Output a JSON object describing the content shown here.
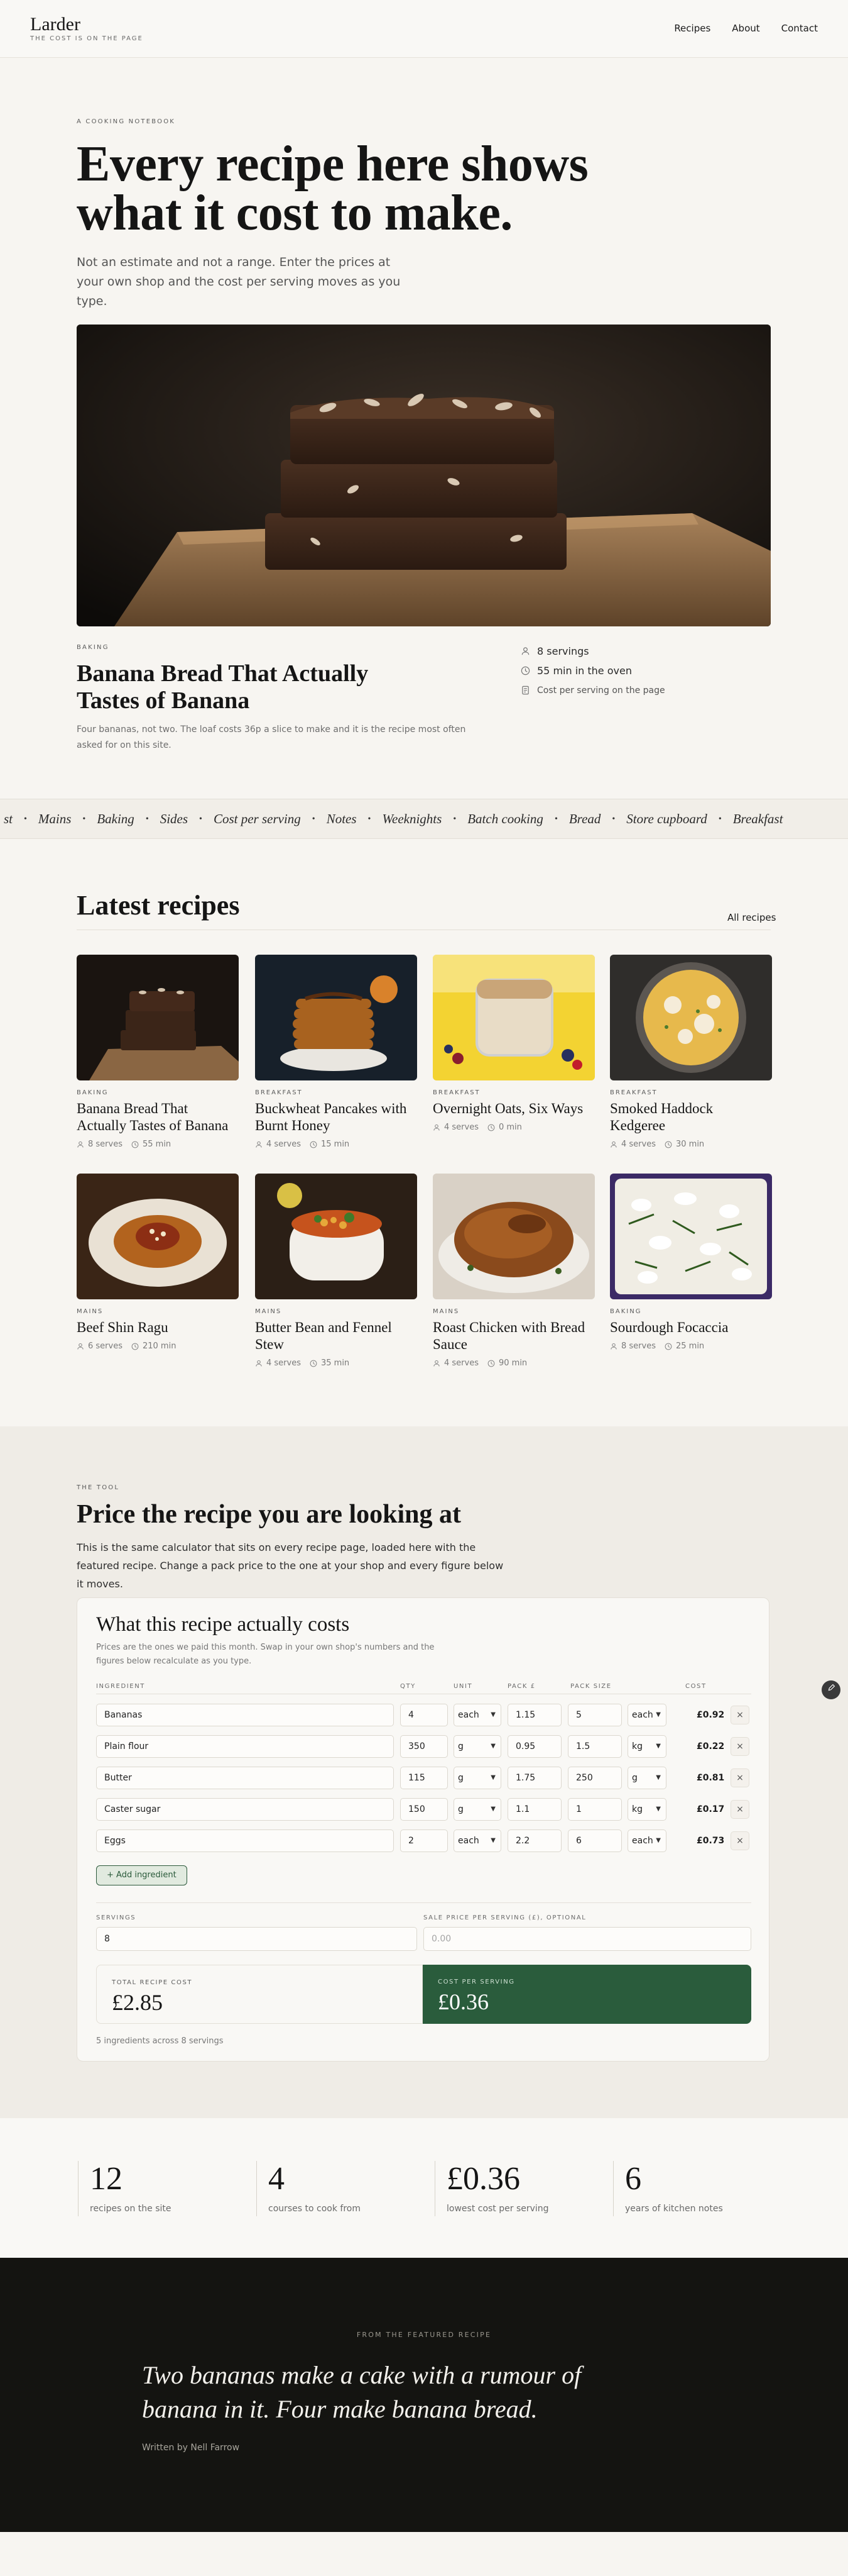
{
  "header": {
    "logo": "Larder",
    "tagline": "THE COST IS ON THE PAGE",
    "nav": [
      "Recipes",
      "About",
      "Contact"
    ]
  },
  "hero": {
    "eyebrow": "A COOKING NOTEBOOK",
    "title": "Every recipe here shows what it cost to make.",
    "lede": "Not an estimate and not a range. Enter the prices at your own shop and the cost per serving moves as you type."
  },
  "featured": {
    "category": "BAKING",
    "title": "Banana Bread That Actually Tastes of Banana",
    "blurb": "Four bananas, not two. The loaf costs 36p a slice to make and it is the recipe most often asked for on this site.",
    "servings": "8 servings",
    "time": "55 min in the oven",
    "cost_note": "Cost per serving on the page"
  },
  "ticker": [
    "st",
    "Mains",
    "Baking",
    "Sides",
    "Cost per serving",
    "Notes",
    "Weeknights",
    "Batch cooking",
    "Bread",
    "Store cupboard",
    "Breakfast"
  ],
  "latest": {
    "title": "Latest recipes",
    "all_link": "All recipes",
    "cards": [
      {
        "category": "BAKING",
        "title": "Banana Bread That Actually Tastes of Banana",
        "serves": "8 serves",
        "time": "55 min",
        "image": "banana-bread"
      },
      {
        "category": "BREAKFAST",
        "title": "Buckwheat Pancakes with Burnt Honey",
        "serves": "4 serves",
        "time": "15 min",
        "image": "pancakes"
      },
      {
        "category": "BREAKFAST",
        "title": "Overnight Oats, Six Ways",
        "serves": "4 serves",
        "time": "0 min",
        "image": "oats"
      },
      {
        "category": "BREAKFAST",
        "title": "Smoked Haddock Kedgeree",
        "serves": "4 serves",
        "time": "30 min",
        "image": "kedgeree"
      },
      {
        "category": "MAINS",
        "title": "Beef Shin Ragu",
        "serves": "6 serves",
        "time": "210 min",
        "image": "ragu"
      },
      {
        "category": "MAINS",
        "title": "Butter Bean and Fennel Stew",
        "serves": "4 serves",
        "time": "35 min",
        "image": "stew"
      },
      {
        "category": "MAINS",
        "title": "Roast Chicken with Bread Sauce",
        "serves": "4 serves",
        "time": "90 min",
        "image": "chicken"
      },
      {
        "category": "BAKING",
        "title": "Sourdough Focaccia",
        "serves": "8 serves",
        "time": "25 min",
        "image": "focaccia"
      }
    ]
  },
  "tool": {
    "eyebrow": "THE TOOL",
    "title": "Price the recipe you are looking at",
    "lede": "This is the same calculator that sits on every recipe page, loaded here with the featured recipe. Change a pack price to the one at your shop and every figure below it moves.",
    "calc": {
      "title": "What this recipe actually costs",
      "note": "Prices are the ones we paid this month. Swap in your own shop's numbers and the figures below recalculate as you type.",
      "headers": {
        "ingredient": "INGREDIENT",
        "qty": "QTY",
        "unit": "UNIT",
        "pack": "PACK £",
        "pack_size": "PACK SIZE",
        "cost": "COST"
      },
      "rows": [
        {
          "name": "Bananas",
          "qty": "4",
          "unit": "each",
          "pack": "1.15",
          "pack_size": "5",
          "pack_unit": "each",
          "cost": "£0.92"
        },
        {
          "name": "Plain flour",
          "qty": "350",
          "unit": "g",
          "pack": "0.95",
          "pack_size": "1.5",
          "pack_unit": "kg",
          "cost": "£0.22"
        },
        {
          "name": "Butter",
          "qty": "115",
          "unit": "g",
          "pack": "1.75",
          "pack_size": "250",
          "pack_unit": "g",
          "cost": "£0.81"
        },
        {
          "name": "Caster sugar",
          "qty": "150",
          "unit": "g",
          "pack": "1.1",
          "pack_size": "1",
          "pack_unit": "kg",
          "cost": "£0.17"
        },
        {
          "name": "Eggs",
          "qty": "2",
          "unit": "each",
          "pack": "2.2",
          "pack_size": "6",
          "pack_unit": "each",
          "cost": "£0.73"
        }
      ],
      "remove_glyph": "×",
      "add_label": "+ Add ingredient",
      "servings_label": "SERVINGS",
      "servings_value": "8",
      "sale_label": "SALE PRICE PER SERVING (£), OPTIONAL",
      "sale_placeholder": "0.00",
      "total_label": "TOTAL RECIPE COST",
      "total_value": "£2.85",
      "per_label": "COST PER SERVING",
      "per_value": "£0.36",
      "footnote": "5 ingredients across 8 servings"
    }
  },
  "stats": [
    {
      "value": "12",
      "label": "recipes on the site"
    },
    {
      "value": "4",
      "label": "courses to cook from"
    },
    {
      "value": "£0.36",
      "label": "lowest cost per serving"
    },
    {
      "value": "6",
      "label": "years of kitchen notes"
    }
  ],
  "quote": {
    "eyebrow": "FROM THE FEATURED RECIPE",
    "text": "Two bananas make a cake with a rumour of banana in it. Four make banana bread.",
    "byline": "Written by Nell Farrow"
  },
  "colors": {
    "accent_green": "#2a5c3c",
    "dark_band": "#141411",
    "page_bg": "#f7f5f1"
  },
  "icons": {
    "servings": "user-icon",
    "time": "clock-icon",
    "cost": "receipt-icon",
    "edit": "pencil-icon"
  }
}
